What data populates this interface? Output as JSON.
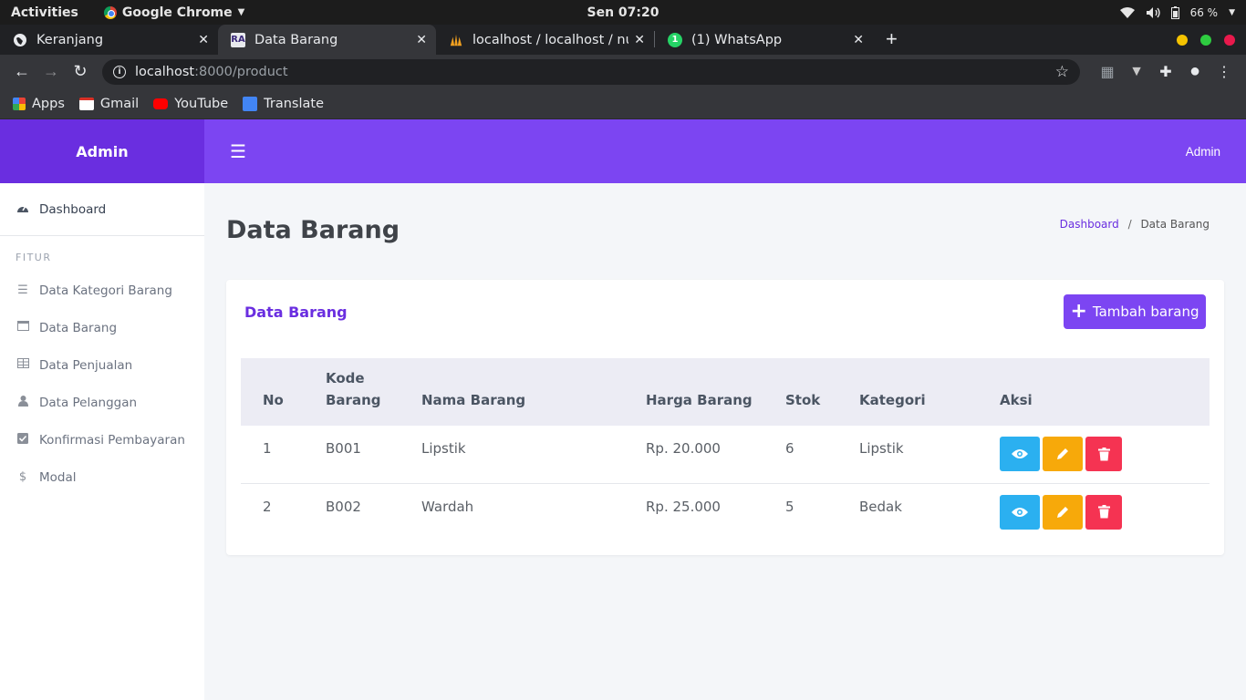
{
  "os": {
    "activities": "Activities",
    "app_name": "Google Chrome",
    "clock": "Sen 07:20",
    "battery": "66 %"
  },
  "browser": {
    "tabs": [
      {
        "title": "Keranjang",
        "icon": "globe-icon"
      },
      {
        "title": "Data Barang",
        "icon": "ra-favicon-icon"
      },
      {
        "title": "localhost / localhost / nus",
        "icon": "phpmyadmin-icon"
      },
      {
        "title": "(1) WhatsApp",
        "icon": "whatsapp-icon"
      }
    ],
    "url_host": "localhost",
    "url_path": ":8000/product",
    "bookmarks": [
      {
        "label": "Apps",
        "icon": "apps-grid-icon"
      },
      {
        "label": "Gmail",
        "icon": "gmail-icon"
      },
      {
        "label": "YouTube",
        "icon": "youtube-icon"
      },
      {
        "label": "Translate",
        "icon": "translate-icon"
      }
    ]
  },
  "app": {
    "brand": "Admin",
    "user": "Admin",
    "sidebar": {
      "dashboard": "Dashboard",
      "section": "FITUR",
      "items": [
        {
          "label": "Data Kategori Barang",
          "icon": "list-icon"
        },
        {
          "label": "Data Barang",
          "icon": "window-icon"
        },
        {
          "label": "Data Penjualan",
          "icon": "table-icon"
        },
        {
          "label": "Data Pelanggan",
          "icon": "user-icon"
        },
        {
          "label": "Konfirmasi Pembayaran",
          "icon": "check-square-icon"
        },
        {
          "label": "Modal",
          "icon": "dollar-icon"
        }
      ]
    },
    "page_title": "Data Barang",
    "breadcrumb": {
      "home": "Dashboard",
      "sep": "/",
      "current": "Data Barang"
    },
    "card_title": "Data Barang",
    "add_button": "Tambah barang",
    "table": {
      "headers": [
        "No",
        "Kode Barang",
        "Nama Barang",
        "Harga Barang",
        "Stok",
        "Kategori",
        "Aksi"
      ],
      "rows": [
        [
          "1",
          "B001",
          "Lipstik",
          "Rp. 20.000",
          "6",
          "Lipstik"
        ],
        [
          "2",
          "B002",
          "Wardah",
          "Rp. 25.000",
          "5",
          "Bedak"
        ]
      ]
    }
  },
  "colors": {
    "brand": "#6a2ee0",
    "topbar": "#7c45f2",
    "view_button": "#2bb0f0",
    "edit_button": "#f7a90a",
    "delete_button": "#f53352"
  }
}
